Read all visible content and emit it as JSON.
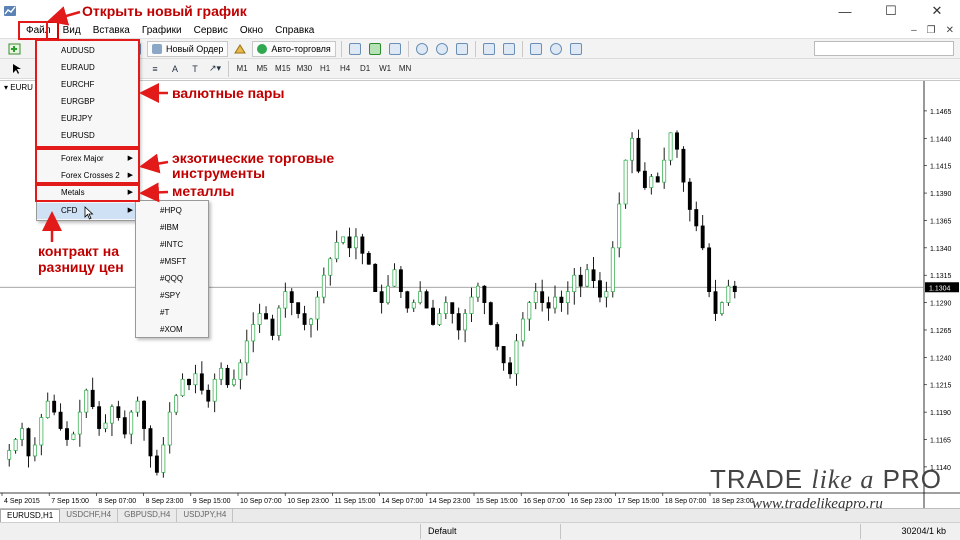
{
  "window": {
    "minimize": "—",
    "maximize": "☐",
    "close": "✕"
  },
  "menubar": {
    "items": [
      "Файл",
      "Вид",
      "Вставка",
      "Графики",
      "Сервис",
      "Окно",
      "Справка"
    ]
  },
  "toolbar": {
    "new_order": "Новый Ордер",
    "auto_trading": "Авто-торговля",
    "timeframes": [
      "M1",
      "M5",
      "M15",
      "M30",
      "H1",
      "H4",
      "D1",
      "W1",
      "MN"
    ],
    "text_tool": "A",
    "label_tool": "T"
  },
  "chart": {
    "window_label": "EURU"
  },
  "chart_data": {
    "type": "candlestick",
    "symbol": "EURUSD",
    "timeframe": "H1",
    "y_ticks": [
      1.1465,
      1.144,
      1.1415,
      1.139,
      1.1365,
      1.134,
      1.1315,
      1.129,
      1.1265,
      1.124,
      1.1215,
      1.119,
      1.1165,
      1.114
    ],
    "current_price": 1.1304,
    "ylim": [
      1.1118,
      1.1485
    ],
    "x_labels": [
      "4 Sep 2015",
      "7 Sep 15:00",
      "8 Sep 07:00",
      "8 Sep 23:00",
      "9 Sep 15:00",
      "10 Sep 07:00",
      "10 Sep 23:00",
      "11 Sep 15:00",
      "14 Sep 07:00",
      "14 Sep 23:00",
      "15 Sep 15:00",
      "16 Sep 07:00",
      "16 Sep 23:00",
      "17 Sep 15:00",
      "18 Sep 07:00",
      "18 Sep 23:00"
    ],
    "closes": [
      1.1155,
      1.1165,
      1.1175,
      1.115,
      1.116,
      1.1185,
      1.12,
      1.119,
      1.1175,
      1.1165,
      1.117,
      1.119,
      1.121,
      1.1195,
      1.1175,
      1.118,
      1.1195,
      1.1185,
      1.117,
      1.119,
      1.12,
      1.1175,
      1.115,
      1.1135,
      1.116,
      1.119,
      1.1205,
      1.122,
      1.1215,
      1.1225,
      1.121,
      1.12,
      1.122,
      1.123,
      1.1215,
      1.122,
      1.1235,
      1.1255,
      1.127,
      1.128,
      1.1275,
      1.126,
      1.1285,
      1.13,
      1.129,
      1.128,
      1.127,
      1.1275,
      1.1295,
      1.1315,
      1.133,
      1.1345,
      1.135,
      1.134,
      1.135,
      1.1335,
      1.1325,
      1.13,
      1.129,
      1.1305,
      1.132,
      1.13,
      1.1285,
      1.129,
      1.13,
      1.1285,
      1.127,
      1.128,
      1.129,
      1.128,
      1.1265,
      1.128,
      1.1295,
      1.1305,
      1.129,
      1.127,
      1.125,
      1.1235,
      1.1225,
      1.1255,
      1.1275,
      1.129,
      1.13,
      1.129,
      1.1285,
      1.1295,
      1.129,
      1.13,
      1.1315,
      1.1305,
      1.132,
      1.131,
      1.1295,
      1.13,
      1.134,
      1.138,
      1.142,
      1.144,
      1.141,
      1.1395,
      1.1405,
      1.14,
      1.142,
      1.1445,
      1.143,
      1.14,
      1.1375,
      1.136,
      1.134,
      1.13,
      1.128,
      1.129,
      1.1305,
      1.13
    ]
  },
  "menu_file": {
    "pairs": [
      "AUDUSD",
      "EURAUD",
      "EURCHF",
      "EURGBP",
      "EURJPY",
      "EURUSD"
    ],
    "groups": [
      "Forex Major",
      "Forex Crosses 2",
      "Metals",
      "CFD"
    ]
  },
  "submenu_cfd": [
    "#HPQ",
    "#IBM",
    "#INTC",
    "#MSFT",
    "#QQQ",
    "#SPY",
    "#T",
    "#XOM"
  ],
  "annotations": {
    "open_new_chart": "Открыть новый график",
    "currency_pairs": "валютные пары",
    "exotic_line1": "экзотические торговые",
    "exotic_line2": "инструменты",
    "metals": "металлы",
    "cfd_line1": "контракт на",
    "cfd_line2": "разницу цен"
  },
  "tabs": [
    "EURUSD,H1",
    "USDCHF,H4",
    "GBPUSD,H4",
    "USDJPY,H4"
  ],
  "statusbar": {
    "profile": "Default",
    "traffic": "30204/1 kb"
  },
  "watermark": {
    "logo_trade": "TRADE",
    "logo_like": "like a",
    "logo_pro": "PRO",
    "url": "www.tradelikeapro.ru"
  },
  "colors": {
    "annotation_red": "#d40000",
    "bear_candle": "#000000",
    "bull_candle": "#27a844"
  }
}
